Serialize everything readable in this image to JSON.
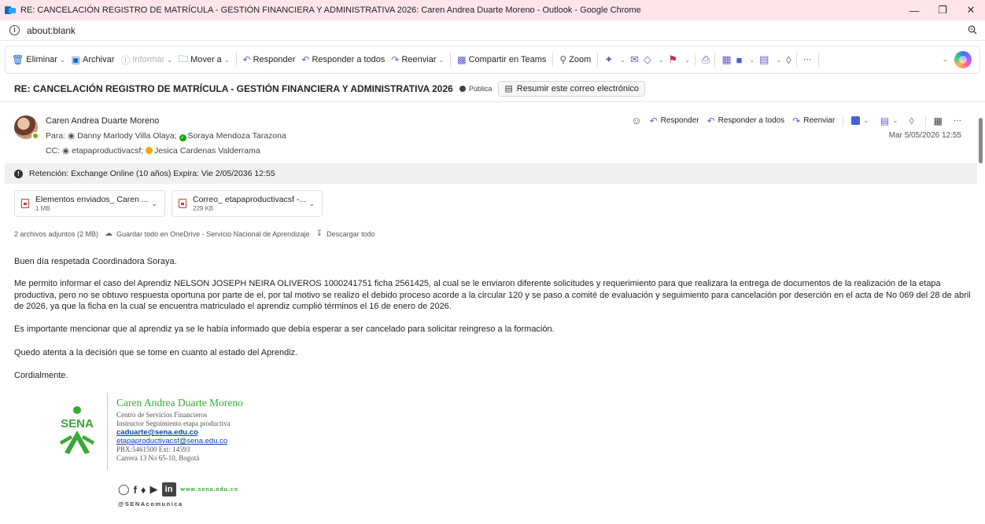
{
  "window": {
    "title": "RE: CANCELACIÓN REGISTRO DE MATRÍCULA - GESTIÓN FINANCIERA Y ADMINISTRATIVA 2026: Caren Andrea Duarte Moreno - Outlook - Google Chrome",
    "url": "about:blank"
  },
  "toolbar": {
    "delete": "Eliminar",
    "archive": "Archivar",
    "report": "Informar",
    "move": "Mover a",
    "reply": "Responder",
    "reply_all": "Responder a todos",
    "forward": "Reenviar",
    "teams": "Compartir en Teams",
    "zoom": "Zoom",
    "more": "···"
  },
  "message": {
    "subject": "RE: CANCELACIÓN REGISTRO DE MATRÍCULA - GESTIÓN FINANCIERA Y ADMINISTRATIVA 2026",
    "visibility": "Pública",
    "summarize": "Resumir este correo electrónico",
    "sender": "Caren Andrea Duarte Moreno",
    "to_label": "Para:",
    "to": [
      "Danny Marlody Villa Olaya;",
      "Soraya Mendoza Tarazona"
    ],
    "cc_label": "CC:",
    "cc": [
      "etapaproductivacsf;",
      "Jesica Cardenas Valderrama"
    ],
    "date": "Mar 5/05/2026 12:55",
    "actions": {
      "reply": "Responder",
      "reply_all": "Responder a todos",
      "forward": "Reenviar",
      "more": "···"
    },
    "retention": "Retención: Exchange Online (10 años) Expira: Vie 2/05/2036 12:55"
  },
  "attachments": {
    "items": [
      {
        "name": "Elementos enviados_ Caren ...",
        "size": "1 MB"
      },
      {
        "name": "Correo_ etapaproductivacsf -...",
        "size": "229 KB"
      }
    ],
    "summary": "2 archivos adjuntos (2 MB)",
    "save_onedrive": "Guardar todo en OneDrive - Servicio Nacional de Aprendizaje",
    "download_all": "Descargar todo"
  },
  "body": {
    "greeting": "Buen día respetada Coordinadora Soraya.",
    "p1": "Me permito informar el caso del Aprendiz NELSON JOSEPH NEIRA OLIVEROS 1000241751 ficha 2561425, al cual se le enviaron diferente solicitudes y requerimiento para que realizara la entrega de documentos de la realización de la etapa productiva, pero no se obtuvo respuesta oportuna por parte de el, por tal motivo se realizo el debido proceso acorde a la circular 120 y se paso a comité de evaluación y seguimiento para cancelación por deserción en el acta de No 069 del 28 de abril de 2026, ya que la ficha en la cual se encuentra matriculado el aprendiz cumplió términos el 16 de enero de 2026.",
    "p2": "Es importante mencionar que al aprendiz ya se le había informado que debía esperar a ser cancelado para solicitar reingreso a la formación.",
    "p3": "Quedo atenta a la decisión que se tome en cuanto al estado del Aprendiz.",
    "closing": "Cordialmente."
  },
  "signature": {
    "logo_text": "SENA",
    "name": "Caren Andrea Duarte Moreno",
    "dept": "Centro de Servicios Financieros",
    "role": "Instructor Seguimiento etapa productiva",
    "email1": "caduarte@sena.edu.co",
    "email2": "etapaproductivacsf@sena.edu.co",
    "phone": "PBX:5461500 Ext: 14593",
    "address": "Carrera 13 No 65-10, Bogotá",
    "web": "www.sena.edu.co",
    "handle": "@SENAcomunica"
  },
  "colors": {
    "accent": "#0f6cbd",
    "sena_green": "#39a935",
    "titlebar": "#ffe5ea"
  }
}
